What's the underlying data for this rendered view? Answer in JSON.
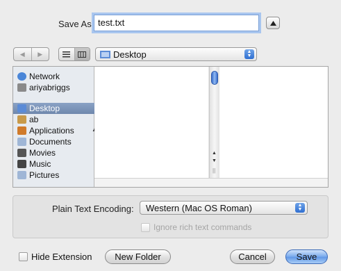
{
  "save_as": {
    "label": "Save As:",
    "filename": "test.txt"
  },
  "location": {
    "current": "Desktop"
  },
  "sidebar": {
    "items": [
      {
        "label": "Network",
        "icon": "network-icon",
        "color": "#4a86d8"
      },
      {
        "label": "ariyabriggs",
        "icon": "hard-drive-icon",
        "color": "#8a8a8a"
      },
      {
        "label": "Desktop",
        "icon": "desktop-folder-icon",
        "color": "#5b8bd6",
        "selected": true
      },
      {
        "label": "ab",
        "icon": "home-icon",
        "color": "#c89a4a"
      },
      {
        "label": "Applications",
        "icon": "applications-icon",
        "color": "#d07a2a"
      },
      {
        "label": "Documents",
        "icon": "documents-icon",
        "color": "#9fb6d6"
      },
      {
        "label": "Movies",
        "icon": "movies-icon",
        "color": "#555555"
      },
      {
        "label": "Music",
        "icon": "music-icon",
        "color": "#444444"
      },
      {
        "label": "Pictures",
        "icon": "pictures-icon",
        "color": "#9fb6d6"
      }
    ]
  },
  "options": {
    "encoding_label": "Plain Text Encoding:",
    "encoding_value": "Western (Mac OS Roman)",
    "ignore_rich_text": "Ignore rich text commands"
  },
  "bottom": {
    "hide_extension": "Hide Extension",
    "new_folder": "New Folder",
    "cancel": "Cancel",
    "save": "Save"
  }
}
